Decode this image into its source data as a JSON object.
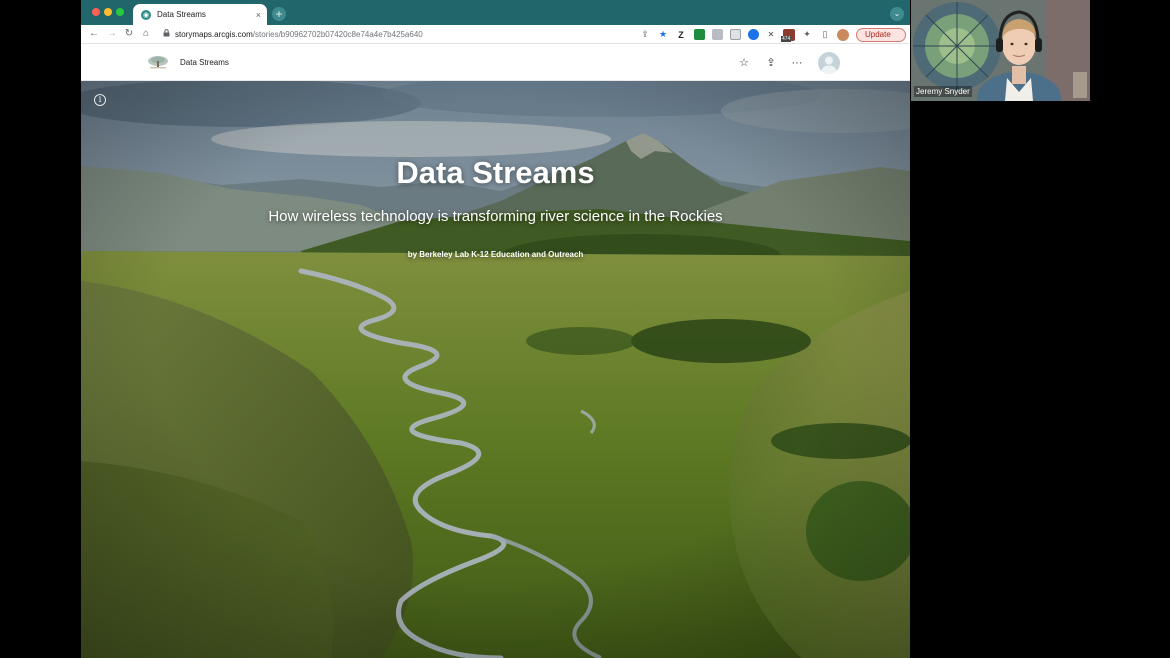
{
  "browser": {
    "tab": {
      "title": "Data Streams",
      "close_glyph": "×"
    },
    "new_tab_glyph": "+",
    "tab_search_glyph": "⌄",
    "nav": {
      "back_glyph": "←",
      "forward_glyph": "→",
      "reload_glyph": "↻",
      "home_glyph": "⌂"
    },
    "address_bar": {
      "lock_glyph": "🔒",
      "host": "storymaps.arcgis.com",
      "path": "/stories/b90962702b07420c8e74a4e7b425a640"
    },
    "toolbar_icons": {
      "share_glyph": "⇪",
      "star_glyph": "★",
      "ext_z_label": "Z",
      "ext_badge_label": "474",
      "puzzle_glyph": "✦",
      "sidebar_glyph": "▯"
    },
    "update_button": "Update",
    "colors": {
      "tabstrip": "#20666b",
      "update_text": "#b3261e"
    }
  },
  "app_header": {
    "title": "Data Streams",
    "icons": {
      "favorite": "star-outline-icon",
      "share": "share-icon",
      "more": "more-icon",
      "account": "avatar-icon"
    },
    "favorite_glyph": "☆",
    "share_glyph": "⇪",
    "more_glyph": "···"
  },
  "cover": {
    "info_glyph": "i",
    "title": "Data Streams",
    "subtitle": "How wireless technology is transforming river science in the Rockies",
    "byline": "by Berkeley Lab K-12 Education and Outreach"
  },
  "video_call": {
    "participant_name": "Jeremy Snyder"
  }
}
